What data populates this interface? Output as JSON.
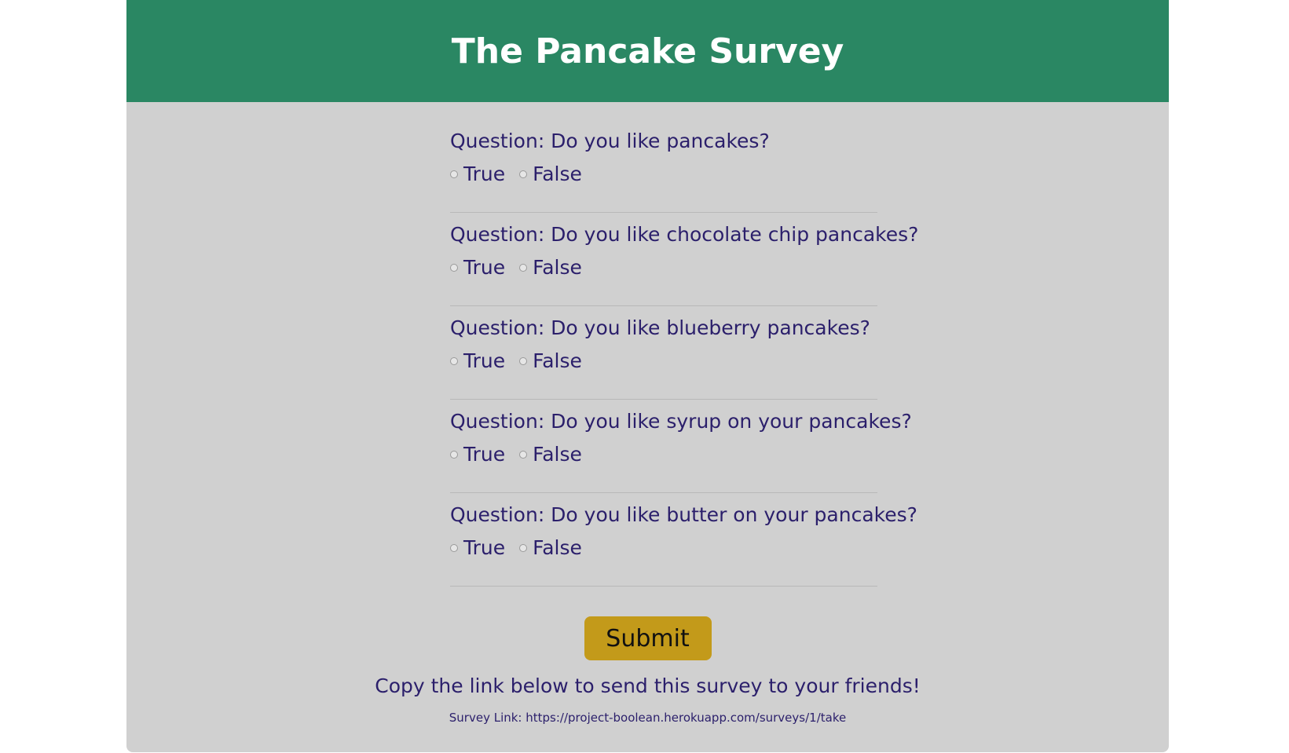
{
  "header": {
    "title": "The Pancake Survey",
    "bg_color": "#2a8763"
  },
  "questions": [
    {
      "text": "Question: Do you like pancakes?",
      "true_label": "True",
      "false_label": "False"
    },
    {
      "text": "Question: Do you like chocolate chip pancakes?",
      "true_label": "True",
      "false_label": "False"
    },
    {
      "text": "Question: Do you like blueberry pancakes?",
      "true_label": "True",
      "false_label": "False"
    },
    {
      "text": "Question: Do you like syrup on your pancakes?",
      "true_label": "True",
      "false_label": "False"
    },
    {
      "text": "Question: Do you like butter on your pancakes?",
      "true_label": "True",
      "false_label": "False"
    }
  ],
  "form": {
    "submit_label": "Submit",
    "submit_color": "#c39a1a"
  },
  "share": {
    "prompt": "Copy the link below to send this survey to your friends!",
    "link_prefix": "Survey Link: ",
    "link_url": "https://project-boolean.herokuapp.com/surveys/1/take"
  }
}
